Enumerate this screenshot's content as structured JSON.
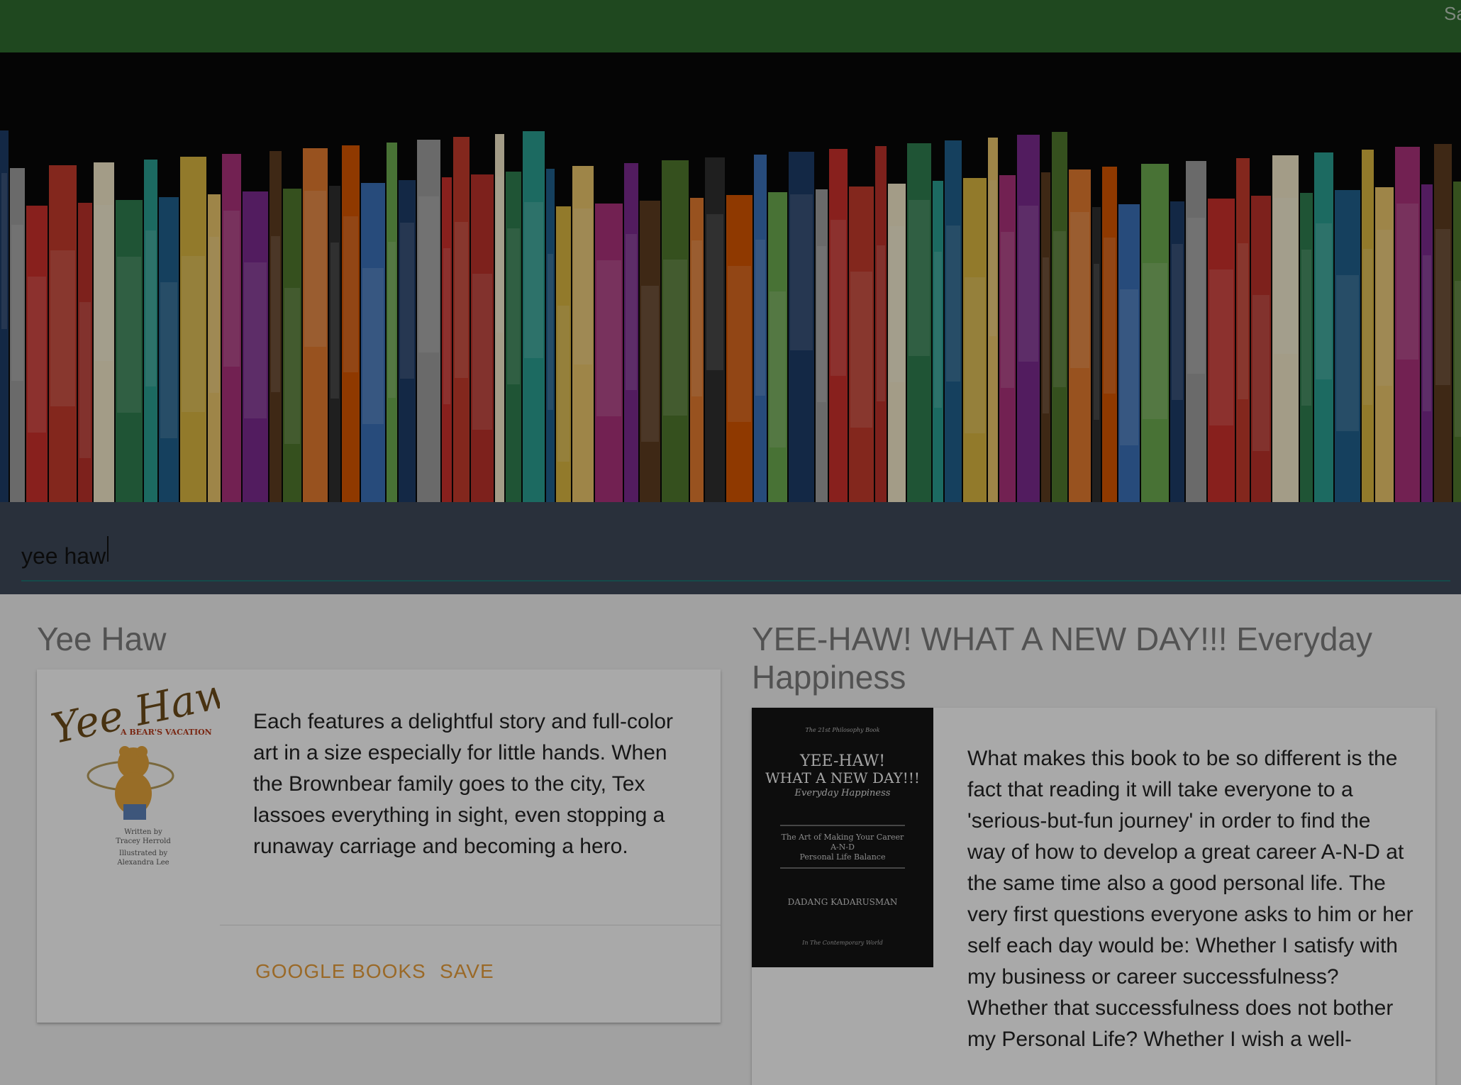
{
  "appbar": {
    "corner_text": "Sa"
  },
  "hero": {
    "image": "bookshelf"
  },
  "search": {
    "value": "yee haw",
    "placeholder": ""
  },
  "results": [
    {
      "title": "Yee Haw",
      "cover": {
        "headline": "Yee Haw!",
        "subtitle": "A BEAR'S VACATION",
        "credits": [
          "Written by",
          "Tracey Herrold",
          "Illustrated by",
          "Alexandra Lee"
        ]
      },
      "description": "Each features a delightful story and full-color art in a size especially for little hands. When the Brownbear family goes to the city, Tex lassoes everything in sight, even stopping a runaway carriage and becoming a hero.",
      "actions": {
        "google_books": "GOOGLE BOOKS",
        "save": "SAVE"
      }
    },
    {
      "title": "YEE-HAW! WHAT A NEW DAY!!! Everyday Happiness",
      "cover": {
        "series": "The 21st Philosophy Book",
        "headline_1": "YEE-HAW!",
        "headline_2": "WHAT A NEW DAY!!!",
        "subtitle": "Everyday Happiness",
        "tagline_1": "The Art of Making Your Career",
        "tagline_2": "A-N-D",
        "tagline_3": "Personal Life Balance",
        "author": "DADANG KADARUSMAN",
        "footer": "In The Contemporary World"
      },
      "description": "What makes this book to be so different is the fact that reading it will take everyone to a 'serious-but-fun journey' in order to find the way of how to develop a great career A-N-D at the same time also a good personal life. The very first questions everyone asks to him or her self each day would be: Whether I satisfy with my business or career successfulness? Whether that successfulness does not bother my Personal Life? Whether I wish a well-"
    }
  ],
  "colors": {
    "appbar": "#2f6a2f",
    "searchbar": "#3d4757",
    "accent_button": "#e49b3a",
    "underline": "#1f6e6e"
  },
  "icons": [
    "text-caret"
  ]
}
